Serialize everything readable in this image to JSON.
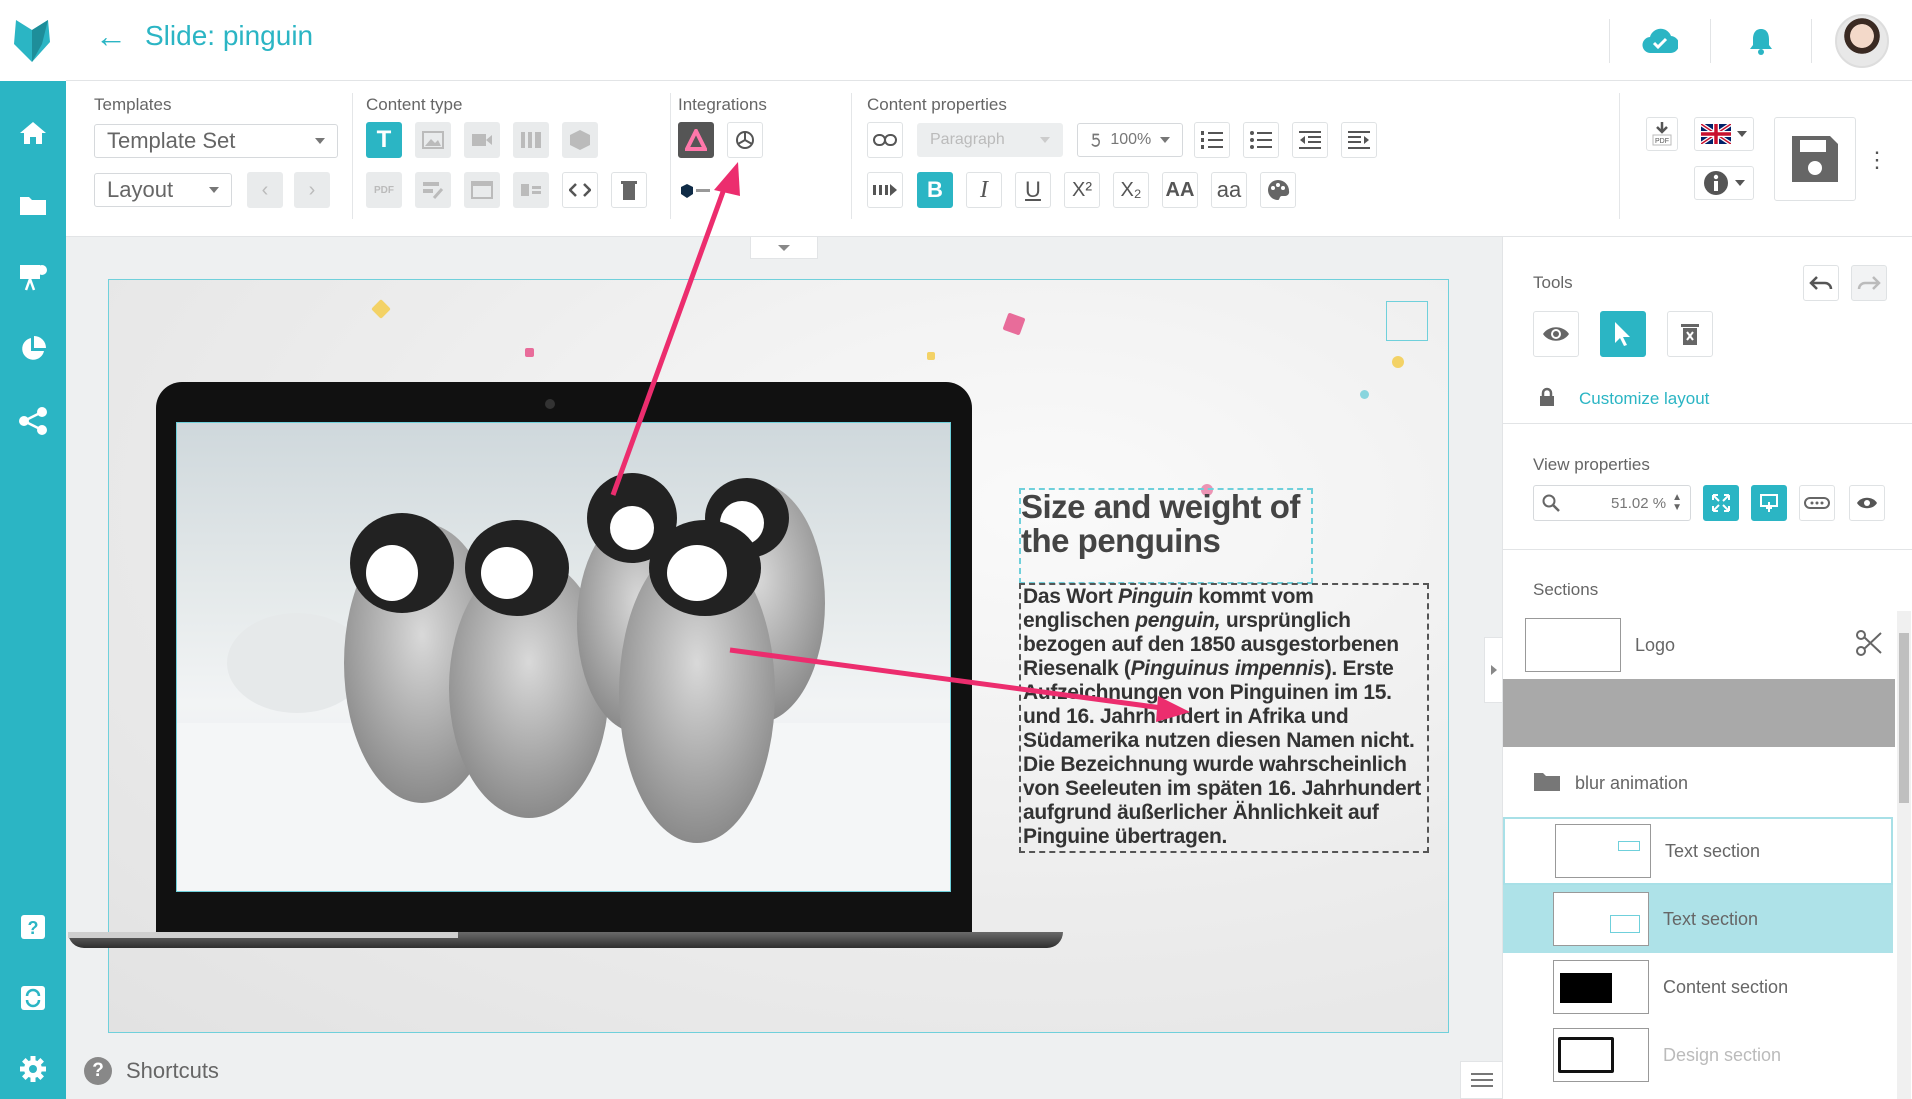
{
  "header": {
    "title": "Slide: pinguin",
    "accent_color": "#2bb5c4"
  },
  "sidebar": {
    "items": [
      {
        "icon": "home-icon"
      },
      {
        "icon": "folder-icon"
      },
      {
        "icon": "presentation-icon"
      },
      {
        "icon": "pie-chart-icon"
      },
      {
        "icon": "share-icon"
      },
      {
        "icon": "help-icon"
      },
      {
        "icon": "sync-icon"
      },
      {
        "icon": "gear-icon"
      }
    ]
  },
  "toolbar": {
    "templates_label": "Templates",
    "template_set": "Template Set",
    "layout": "Layout",
    "content_type_label": "Content type",
    "integrations_label": "Integrations",
    "content_properties_label": "Content properties",
    "paragraph": "Paragraph",
    "font_size": "100%",
    "pdf_label": "PDF"
  },
  "slide": {
    "heading": "Size and weight of the penguins",
    "body_parts": [
      "Das Wort ",
      "Pinguin",
      " kommt vom englischen ",
      "penguin,",
      " ursprünglich bezogen auf den 1850 ausgestorbenen Riesenalk (",
      "Pinguinus impennis",
      "). Erste Aufzeichnungen von Pinguinen im 15. und 16. Jahrhundert in Afrika und Südamerika nutzen diesen Namen nicht. Die Bezeichnung wurde wahrscheinlich von Seeleuten im späten 16. Jahrhundert aufgrund äußerlicher Ähnlichkeit auf Pinguine übertragen."
    ]
  },
  "shortcuts": "Shortcuts",
  "right_panel": {
    "tools_label": "Tools",
    "customize_layout": "Customize layout",
    "view_properties_label": "View properties",
    "zoom": "51.02 %",
    "sections_label": "Sections",
    "sections": [
      {
        "label": "Logo"
      },
      {
        "label": "blur animation"
      },
      {
        "label": "Text section"
      },
      {
        "label": "Text section"
      },
      {
        "label": "Content section"
      },
      {
        "label": "Design section"
      }
    ]
  }
}
